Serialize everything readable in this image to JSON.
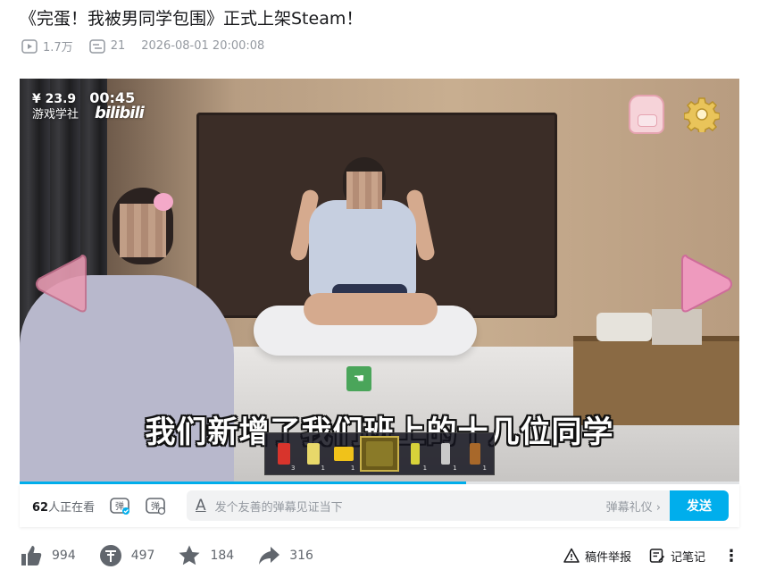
{
  "video": {
    "title": "《完蛋！我被男同学包围》正式上架Steam！",
    "play_count": "1.7万",
    "danmaku_count": "21",
    "publish_time": "2026-08-01 20:00:08"
  },
  "player": {
    "overlay": {
      "money": "¥ 23.9",
      "timer": "00:45",
      "studio": "游戏学社",
      "brand": "bilibili"
    },
    "subtitle": "我们新增了我们班上的十几位同学",
    "progress": 0.62,
    "inventory_counts": [
      "3",
      "1",
      "1",
      "1",
      "1",
      "1"
    ],
    "icons": [
      "backpack-icon",
      "gear-icon",
      "arrow-left-icon",
      "arrow-right-icon",
      "hand-cursor-icon"
    ]
  },
  "danmaku_bar": {
    "viewers_count": "62",
    "viewers_suffix": "人正在看",
    "input_placeholder": "发个友善的弹幕见证当下",
    "etiquette_label": "弹幕礼仪 ›",
    "send_label": "发送"
  },
  "actions": {
    "like": "994",
    "coin": "497",
    "favorite": "184",
    "share": "316",
    "report": "稿件举报",
    "notes": "记笔记"
  },
  "colors": {
    "accent": "#00aeec",
    "text_primary": "#18191c",
    "text_secondary": "#61666d",
    "text_muted": "#9499a0"
  }
}
